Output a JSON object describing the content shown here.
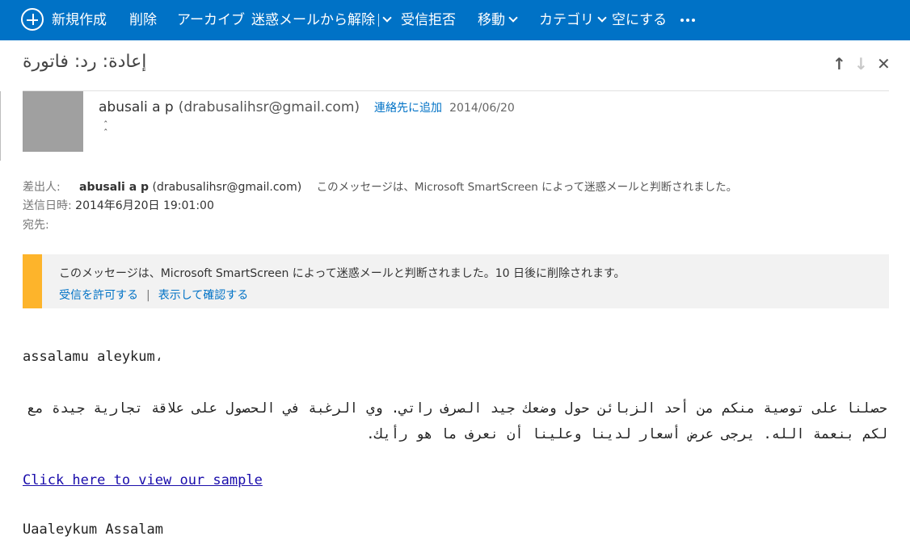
{
  "toolbar": {
    "new_label": "新規作成",
    "delete_label": "削除",
    "archive_label": "アーカイブ",
    "not_junk_label": "迷惑メールから解除",
    "block_label": "受信拒否",
    "move_label": "移動",
    "category_label": "カテゴリ",
    "empty_label": "空にする"
  },
  "message": {
    "subject": "إعادة: رد: فاتورة",
    "sender_name": "abusali a p",
    "sender_email": "(drabusalihsr@gmail.com)",
    "add_contact": "連絡先に追加",
    "date": "2014/06/20"
  },
  "details": {
    "from_label": "差出人:",
    "from_name": "abusali a p",
    "from_email": "(drabusalihsr@gmail.com)",
    "junk_note": "このメッセージは、Microsoft SmartScreen によって迷惑メールと判断されました。",
    "sent_label": "送信日時:",
    "sent_value": "2014年6月20日 19:01:00",
    "to_label": "宛先:"
  },
  "banner": {
    "text": "このメッセージは、Microsoft SmartScreen によって迷惑メールと判断されました。10 日後に削除されます。",
    "allow_link": "受信を許可する",
    "separator": "|",
    "show_link": "表示して確認する"
  },
  "body": {
    "greeting": "assalamu aleykum،",
    "paragraph": "حصلنا على توصية منكم من أحد الزبائن حول وضعك جيد الصرف راتي. وي الرغبة في الحصول على علاقة تجارية جيدة مع لكم بنعمة الله. يرجى عرض أسعار لدينا وعلينا أن نعرف ما هو رأيك.",
    "link_text": "Click here to view our sample",
    "closing": "Uaaleykum Assalam"
  },
  "colors": {
    "toolbar_bg": "#0072c6",
    "banner_accent": "#fdb42b",
    "link": "#0072c6"
  },
  "icons": {
    "new": "plus-circle-icon",
    "up": "arrow-up-icon",
    "down": "arrow-down-icon",
    "close": "close-icon",
    "more": "ellipsis-icon",
    "expand": "expand-icon"
  }
}
